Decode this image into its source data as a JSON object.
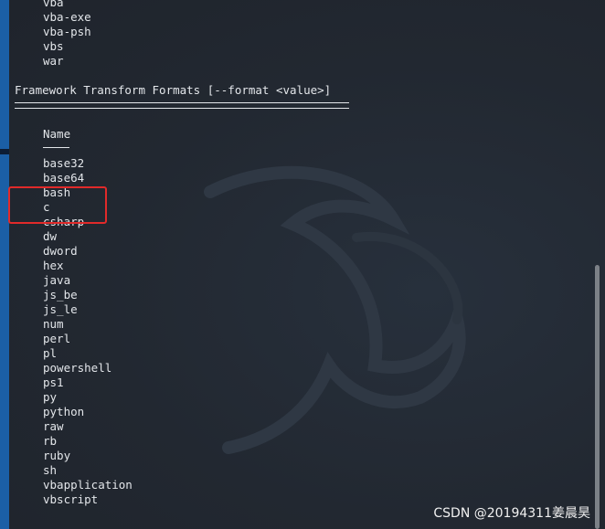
{
  "terminal": {
    "previous_lines": [
      "vba",
      "vba-exe",
      "vba-psh",
      "vbs",
      "war"
    ],
    "section_title": "Framework Transform Formats [--format <value>]",
    "column_header": "Name",
    "formats": [
      "base32",
      "base64",
      "bash",
      "c",
      "csharp",
      "dw",
      "dword",
      "hex",
      "java",
      "js_be",
      "js_le",
      "num",
      "perl",
      "pl",
      "powershell",
      "ps1",
      "py",
      "python",
      "raw",
      "rb",
      "ruby",
      "sh",
      "vbapplication",
      "vbscript"
    ],
    "highlighted_items": [
      "bash",
      "c",
      "csharp"
    ]
  },
  "colors": {
    "terminal_bg": "#222831",
    "text": "#e3e6ea",
    "highlight": "#e12a2a",
    "desktop": "#1b5fa6"
  },
  "icons": {
    "watermark": "kali-dragon-icon"
  },
  "watermark_text": "CSDN @20194311姜晨昊"
}
